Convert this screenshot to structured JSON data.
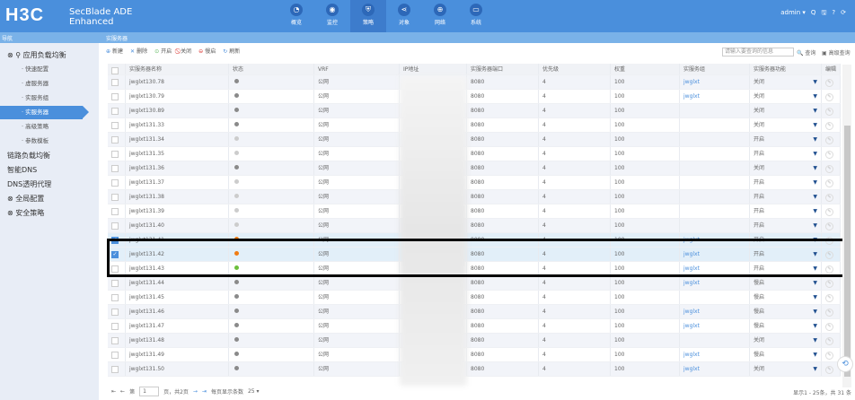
{
  "header": {
    "logo": "H3C",
    "product_line1": "SecBlade ADE",
    "product_line2": "Enhanced",
    "user": "admin ▾",
    "tools": [
      "Q",
      "🖫",
      "?",
      "⟳"
    ],
    "nav": [
      {
        "label": "概览",
        "icon": "dashboard-icon",
        "glyph": "◔"
      },
      {
        "label": "监控",
        "icon": "camera-icon",
        "glyph": "◉"
      },
      {
        "label": "策略",
        "icon": "shield-icon",
        "glyph": "⛨",
        "active": true
      },
      {
        "label": "对象",
        "icon": "share-icon",
        "glyph": "⋖"
      },
      {
        "label": "网络",
        "icon": "globe-icon",
        "glyph": "⊕"
      },
      {
        "label": "系统",
        "icon": "monitor-icon",
        "glyph": "▭"
      }
    ]
  },
  "subbar": {
    "nav_title": "导航",
    "breadcrumb": "实服务器"
  },
  "sidebar": [
    {
      "label": "⊗ ⚲ 应用负载均衡",
      "type": "top"
    },
    {
      "label": "· 快速配置",
      "type": "sub"
    },
    {
      "label": "· 虚服务器",
      "type": "sub"
    },
    {
      "label": "· 实服务组",
      "type": "sub"
    },
    {
      "label": "· 实服务器",
      "type": "sub",
      "active": true
    },
    {
      "label": "· 高级策略",
      "type": "sub"
    },
    {
      "label": "· 参数模板",
      "type": "sub"
    },
    {
      "label": "  链路负载均衡",
      "type": "top"
    },
    {
      "label": "  智能DNS",
      "type": "top"
    },
    {
      "label": "  DNS透明代理",
      "type": "top"
    },
    {
      "label": "⊗ 全局配置",
      "type": "top"
    },
    {
      "label": "⊗ 安全策略",
      "type": "top"
    }
  ],
  "toolbar": [
    {
      "label": "新建",
      "glyph": "⊕",
      "icon": "add-icon",
      "color": "#4a8fdc"
    },
    {
      "label": "删除",
      "glyph": "✕",
      "icon": "delete-icon",
      "color": "#4a8fdc"
    },
    {
      "label": "开启",
      "glyph": "⊙",
      "icon": "enable-icon",
      "color": "#5cb85c"
    },
    {
      "label": "关闭",
      "glyph": "⃠",
      "icon": "disable-icon",
      "color": "#d9302c"
    },
    {
      "label": "慢启",
      "glyph": "⊖",
      "icon": "slow-start-icon",
      "color": "#d9302c"
    },
    {
      "label": "刷新",
      "glyph": "↻",
      "icon": "refresh-icon",
      "color": "#4a8fdc"
    }
  ],
  "search": {
    "placeholder": "请输入要查询的信息",
    "query": "🔍 查询",
    "advanced": "▣ 高级查询"
  },
  "columns": [
    "实服务器名称",
    "状态",
    "VRF",
    "IP地址",
    "实服务器端口",
    "优先级",
    "权重",
    "实服务组",
    "实服务器功能",
    "编辑"
  ],
  "status_colors": {
    "dark": "#8a8a8a",
    "light": "#cccccc",
    "orange": "#f07c14",
    "green": "#6cbf3c"
  },
  "rows": [
    {
      "name": "jwglxt130.78",
      "status": "dark",
      "vrf": "公网",
      "port": "8080",
      "pri": "4",
      "w": "100",
      "group": "jwglxt",
      "func": "关闭"
    },
    {
      "name": "jwglxt130.79",
      "status": "dark",
      "vrf": "公网",
      "port": "8080",
      "pri": "4",
      "w": "100",
      "group": "jwglxt",
      "func": "关闭"
    },
    {
      "name": "jwglxt130.89",
      "status": "dark",
      "vrf": "公网",
      "port": "8080",
      "pri": "4",
      "w": "100",
      "group": "",
      "func": "关闭"
    },
    {
      "name": "jwglxt131.33",
      "status": "dark",
      "vrf": "公网",
      "port": "8080",
      "pri": "4",
      "w": "100",
      "group": "",
      "func": "关闭"
    },
    {
      "name": "jwglxt131.34",
      "status": "light",
      "vrf": "公网",
      "port": "8080",
      "pri": "4",
      "w": "100",
      "group": "",
      "func": "开启"
    },
    {
      "name": "jwglxt131.35",
      "status": "light",
      "vrf": "公网",
      "port": "8080",
      "pri": "4",
      "w": "100",
      "group": "",
      "func": "开启"
    },
    {
      "name": "jwglxt131.36",
      "status": "dark",
      "vrf": "公网",
      "port": "8080",
      "pri": "4",
      "w": "100",
      "group": "",
      "func": "关闭"
    },
    {
      "name": "jwglxt131.37",
      "status": "light",
      "vrf": "公网",
      "port": "8080",
      "pri": "4",
      "w": "100",
      "group": "",
      "func": "开启"
    },
    {
      "name": "jwglxt131.38",
      "status": "light",
      "vrf": "公网",
      "port": "8080",
      "pri": "4",
      "w": "100",
      "group": "",
      "func": "开启"
    },
    {
      "name": "jwglxt131.39",
      "status": "light",
      "vrf": "公网",
      "port": "8080",
      "pri": "4",
      "w": "100",
      "group": "",
      "func": "开启"
    },
    {
      "name": "jwglxt131.40",
      "status": "light",
      "vrf": "公网",
      "port": "8080",
      "pri": "4",
      "w": "100",
      "group": "",
      "func": "开启"
    },
    {
      "name": "jwglxt131.41",
      "status": "orange",
      "vrf": "公网",
      "port": "8080",
      "pri": "4",
      "w": "100",
      "group": "jwglxt",
      "func": "开启",
      "checked": true
    },
    {
      "name": "jwglxt131.42",
      "status": "orange",
      "vrf": "公网",
      "port": "8080",
      "pri": "4",
      "w": "100",
      "group": "jwglxt",
      "func": "开启",
      "checked": true
    },
    {
      "name": "jwglxt131.43",
      "status": "green",
      "vrf": "公网",
      "port": "8080",
      "pri": "4",
      "w": "100",
      "group": "jwglxt",
      "func": "开启"
    },
    {
      "name": "jwglxt131.44",
      "status": "dark",
      "vrf": "公网",
      "port": "8080",
      "pri": "4",
      "w": "100",
      "group": "jwglxt",
      "func": "慢启"
    },
    {
      "name": "jwglxt131.45",
      "status": "dark",
      "vrf": "公网",
      "port": "8080",
      "pri": "4",
      "w": "100",
      "group": "",
      "func": "慢启"
    },
    {
      "name": "jwglxt131.46",
      "status": "dark",
      "vrf": "公网",
      "port": "8080",
      "pri": "4",
      "w": "100",
      "group": "jwglxt",
      "func": "慢启"
    },
    {
      "name": "jwglxt131.47",
      "status": "dark",
      "vrf": "公网",
      "port": "8080",
      "pri": "4",
      "w": "100",
      "group": "jwglxt",
      "func": "慢启"
    },
    {
      "name": "jwglxt131.48",
      "status": "dark",
      "vrf": "公网",
      "port": "8080",
      "pri": "4",
      "w": "100",
      "group": "",
      "func": "关闭"
    },
    {
      "name": "jwglxt131.49",
      "status": "dark",
      "vrf": "公网",
      "port": "8080",
      "pri": "4",
      "w": "100",
      "group": "jwglxt",
      "func": "慢启"
    },
    {
      "name": "jwglxt131.50",
      "status": "dark",
      "vrf": "公网",
      "port": "8080",
      "pri": "4",
      "w": "100",
      "group": "jwglxt",
      "func": "关闭"
    }
  ],
  "pagination": {
    "first": "⇤",
    "prev": "←",
    "page_prefix": "第",
    "page": "1",
    "page_suffix": "页，共2页",
    "next": "→",
    "last": "⇥",
    "per_page_label": "每页显示条数",
    "per_page": "25 ▾",
    "summary": "显示1 - 25条，共 31 条"
  }
}
